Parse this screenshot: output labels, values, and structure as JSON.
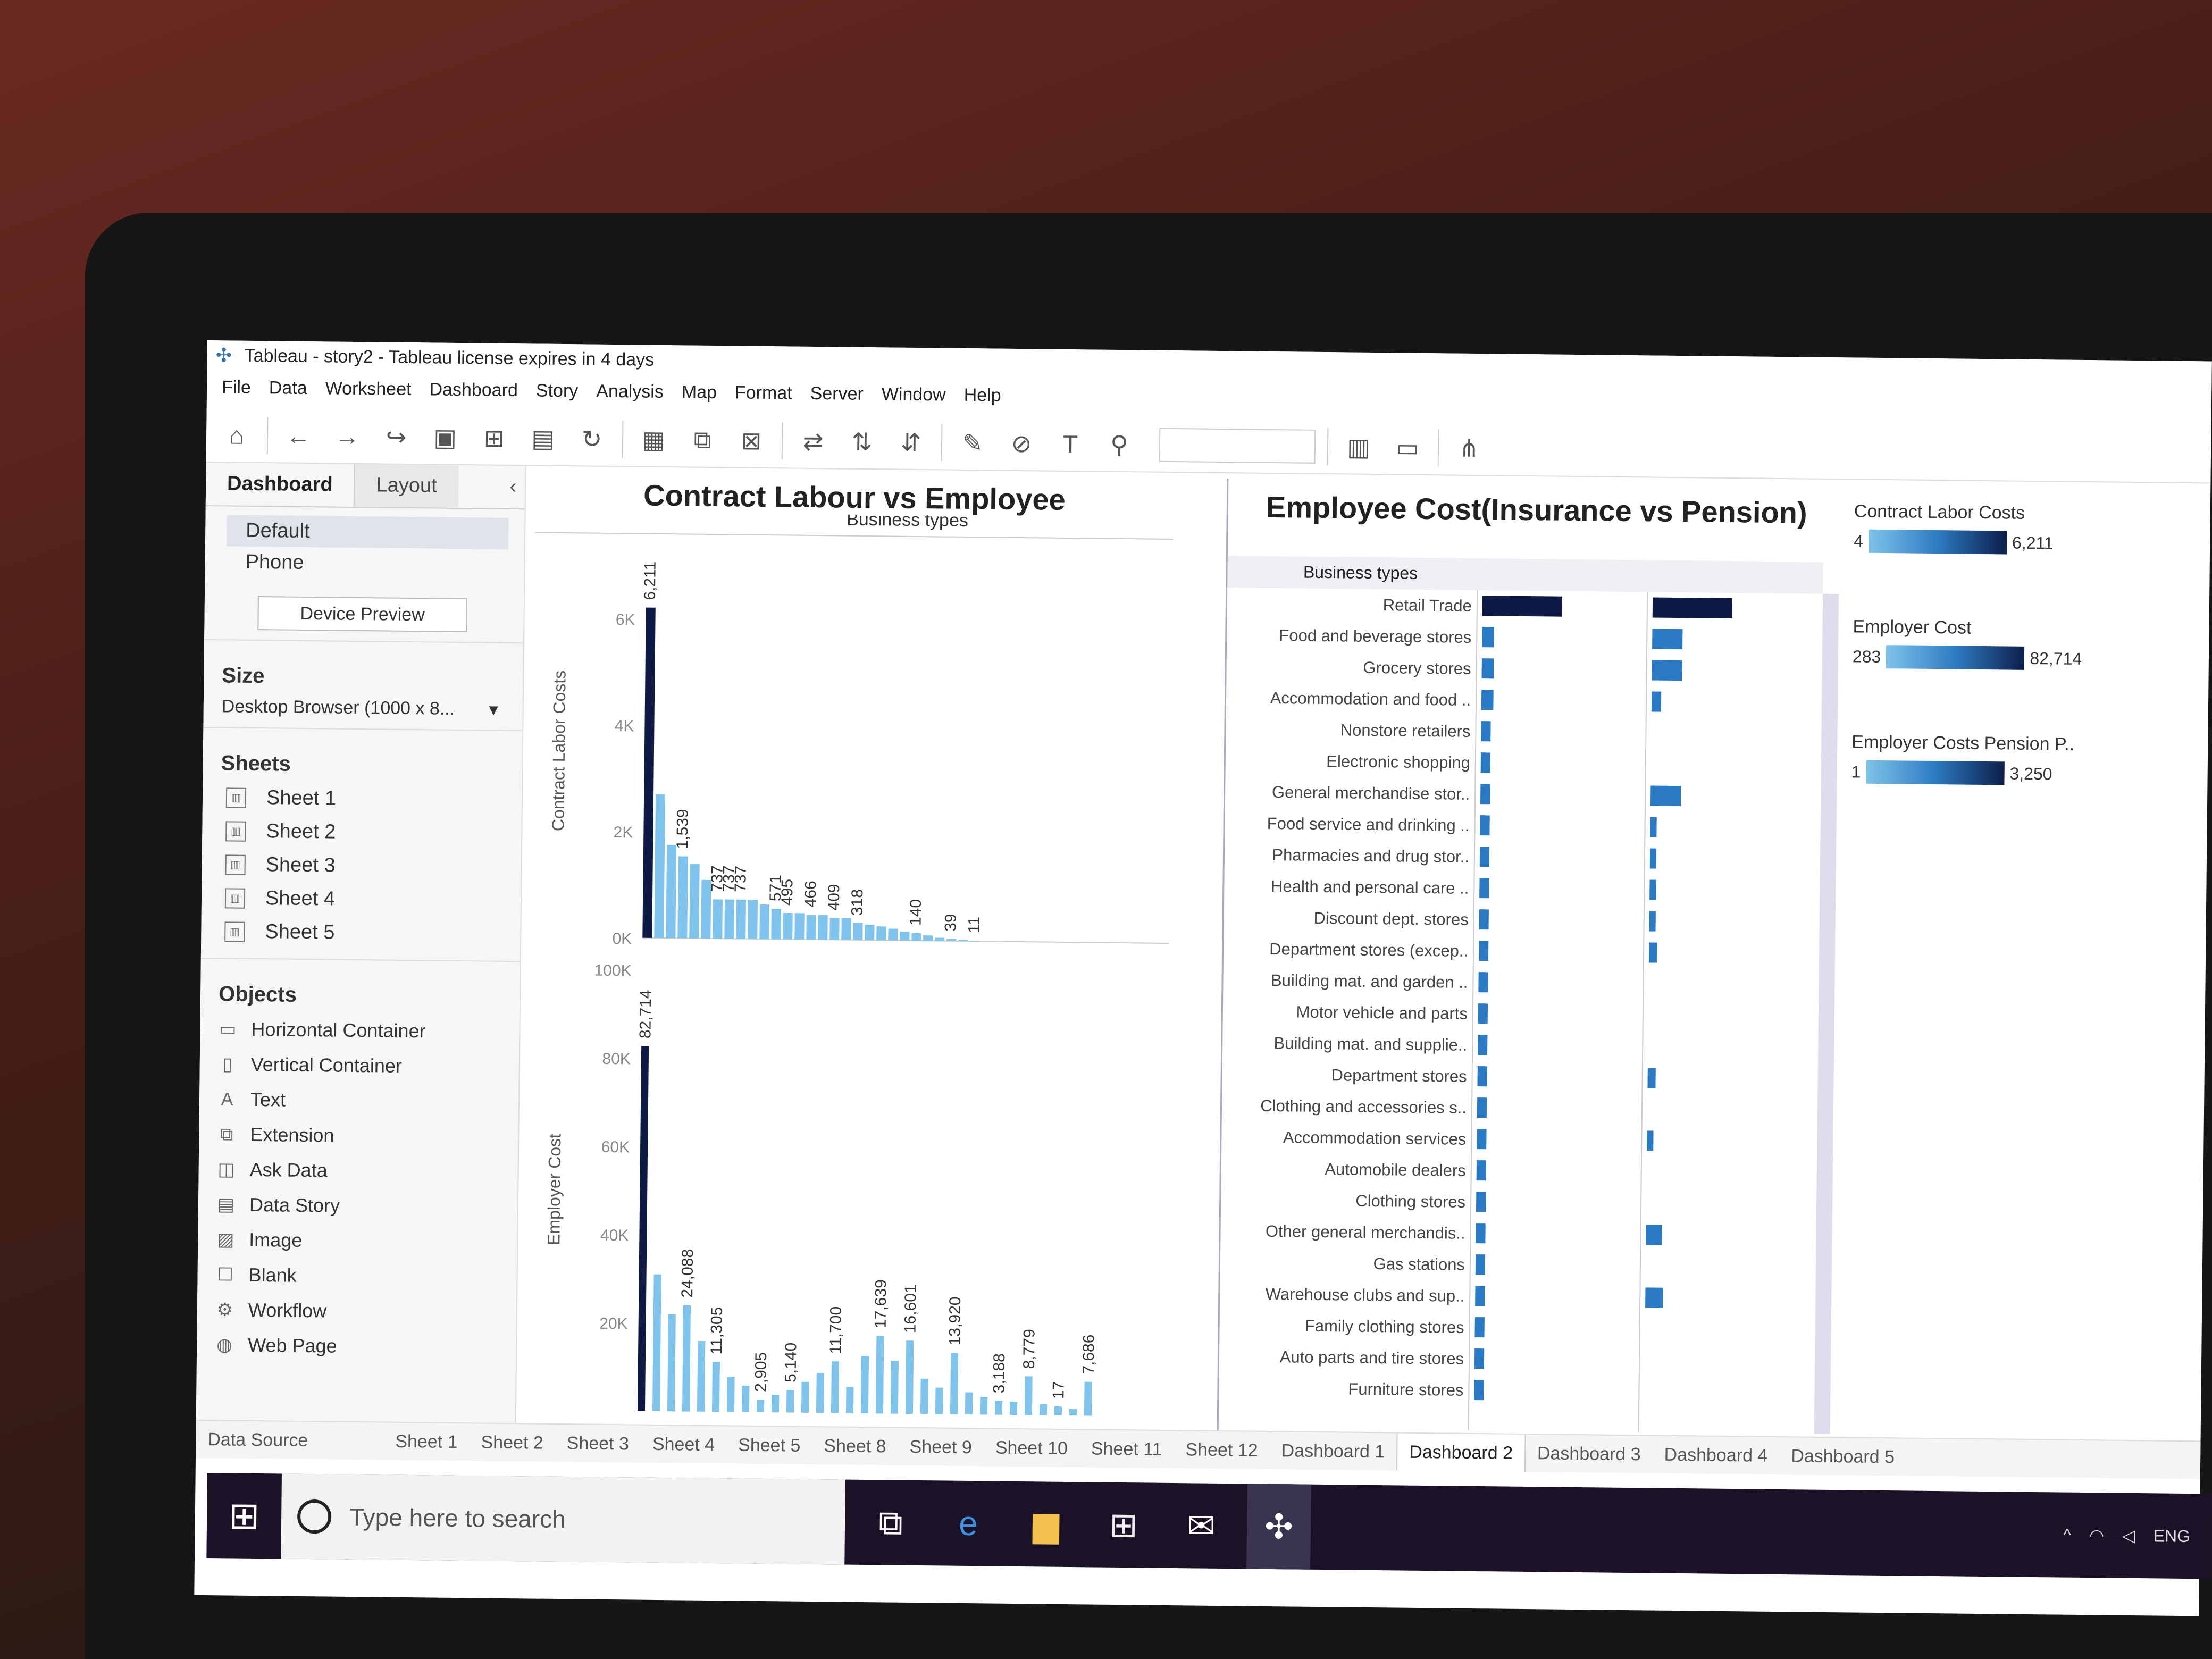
{
  "window": {
    "title": "Tableau - story2 - Tableau license expires in 4 days"
  },
  "menu": [
    "File",
    "Data",
    "Worksheet",
    "Dashboard",
    "Story",
    "Analysis",
    "Map",
    "Format",
    "Server",
    "Window",
    "Help"
  ],
  "left_pane": {
    "tabs": {
      "dashboard": "Dashboard",
      "layout": "Layout"
    },
    "devices": [
      "Default",
      "Phone"
    ],
    "device_preview": "Device Preview",
    "size_title": "Size",
    "size_value": "Desktop Browser (1000 x 8...",
    "sheets_title": "Sheets",
    "sheets": [
      "Sheet 1",
      "Sheet 2",
      "Sheet 3",
      "Sheet 4",
      "Sheet 5"
    ],
    "objects_title": "Objects",
    "objects": [
      "Horizontal Container",
      "Vertical Container",
      "Text",
      "Extension",
      "Ask Data",
      "Data Story",
      "Image",
      "Blank",
      "Workflow",
      "Web Page"
    ]
  },
  "chart_data": [
    {
      "type": "bar",
      "title": "Contract Labour vs Employee",
      "xlabel": "Business types",
      "ylabel": "Contract Labor Costs",
      "ylim": [
        0,
        7000
      ],
      "ticks": [
        "0K",
        "2K",
        "4K",
        "6K"
      ],
      "values": [
        6211,
        2700,
        1750,
        1539,
        1400,
        1100,
        737,
        737,
        737,
        737,
        650,
        571,
        495,
        495,
        466,
        466,
        409,
        409,
        318,
        290,
        260,
        220,
        170,
        140,
        100,
        60,
        39,
        25,
        11
      ],
      "labels": [
        "6,211",
        "1,539",
        "737",
        "737",
        "737",
        "571",
        "495",
        "466",
        "409",
        "318",
        "140",
        "39",
        "11"
      ]
    },
    {
      "type": "bar",
      "ylabel": "Employer Cost",
      "ylim": [
        0,
        100000
      ],
      "ticks": [
        "20K",
        "40K",
        "60K",
        "80K",
        "100K"
      ],
      "values": [
        82714,
        31000,
        22000,
        24088,
        16000,
        11305,
        8000,
        6000,
        2905,
        4000,
        5140,
        7000,
        9000,
        11700,
        6000,
        13000,
        17639,
        12000,
        16601,
        8000,
        6000,
        13920,
        5000,
        4000,
        3188,
        3000,
        8779,
        2500,
        2017,
        1500,
        7686
      ],
      "labels": [
        "82,714",
        "24,088",
        "11,305",
        "2,905",
        "5,140",
        "11,700",
        "17,639",
        "16,601",
        "13,920",
        "3,188",
        "8,779",
        "17",
        "7,686"
      ]
    },
    {
      "type": "bar",
      "title": "Employee Cost(Insurance vs Pension)",
      "header": "Business types",
      "categories": [
        "Retail Trade",
        "Food and beverage stores",
        "Grocery stores",
        "Accommodation and food ..",
        "Nonstore retailers",
        "Electronic shopping",
        "General merchandise stor..",
        "Food service and drinking ..",
        "Pharmacies and drug stor..",
        "Health and personal care ..",
        "Discount dept. stores",
        "Department stores (excep..",
        "Building mat. and garden ..",
        "Motor vehicle and parts",
        "Building mat. and supplie..",
        "Department stores",
        "Clothing and accessories s..",
        "Accommodation services",
        "Automobile dealers",
        "Clothing stores",
        "Other general merchandis..",
        "Gas stations",
        "Warehouse clubs and sup..",
        "Family clothing stores",
        "Auto parts and tire stores",
        "Furniture stores"
      ],
      "series": [
        {
          "values": [
            1.0,
            0.15,
            0.15,
            0.15,
            0.1,
            0.1,
            0.1,
            0.08,
            0.08,
            0.07,
            0.06,
            0.06,
            0.05,
            0.05,
            0.05,
            0.04,
            0.04,
            0.04,
            0.03,
            0.03,
            0.03,
            0.02,
            0.02,
            0.02,
            0.02,
            0.02
          ]
        },
        {
          "values": [
            1.0,
            0.38,
            0.38,
            0.12,
            0.0,
            0.0,
            0.38,
            0.04,
            0.06,
            0.08,
            0.08,
            0.1,
            0.0,
            0.0,
            0.0,
            0.1,
            0.0,
            0.02,
            0.0,
            0.0,
            0.2,
            0.0,
            0.22,
            0.0,
            0.0,
            0.0
          ]
        }
      ]
    }
  ],
  "legends": [
    {
      "title": "Contract Labor Costs",
      "min": "4",
      "max": "6,211"
    },
    {
      "title": "Employer Cost",
      "min": "283",
      "max": "82,714"
    },
    {
      "title": "Employer Costs Pension P..",
      "min": "1",
      "max": "3,250"
    }
  ],
  "tabs": {
    "data_source": "Data Source",
    "items": [
      "Sheet 1",
      "Sheet 2",
      "Sheet 3",
      "Sheet 4",
      "Sheet 5",
      "Sheet 8",
      "Sheet 9",
      "Sheet 10",
      "Sheet 11",
      "Sheet 12",
      "Dashboard 1",
      "Dashboard 2",
      "Dashboard 3",
      "Dashboard 4",
      "Dashboard 5"
    ],
    "active": "Dashboard 2"
  },
  "taskbar": {
    "search_placeholder": "Type here to search",
    "tray_lang": "ENG"
  },
  "colors": {
    "dark_bar": "#0e1a45",
    "light_bar": "#7ec4ec",
    "mid_bar": "#2a79c4",
    "taskbar": "#1c1228"
  }
}
